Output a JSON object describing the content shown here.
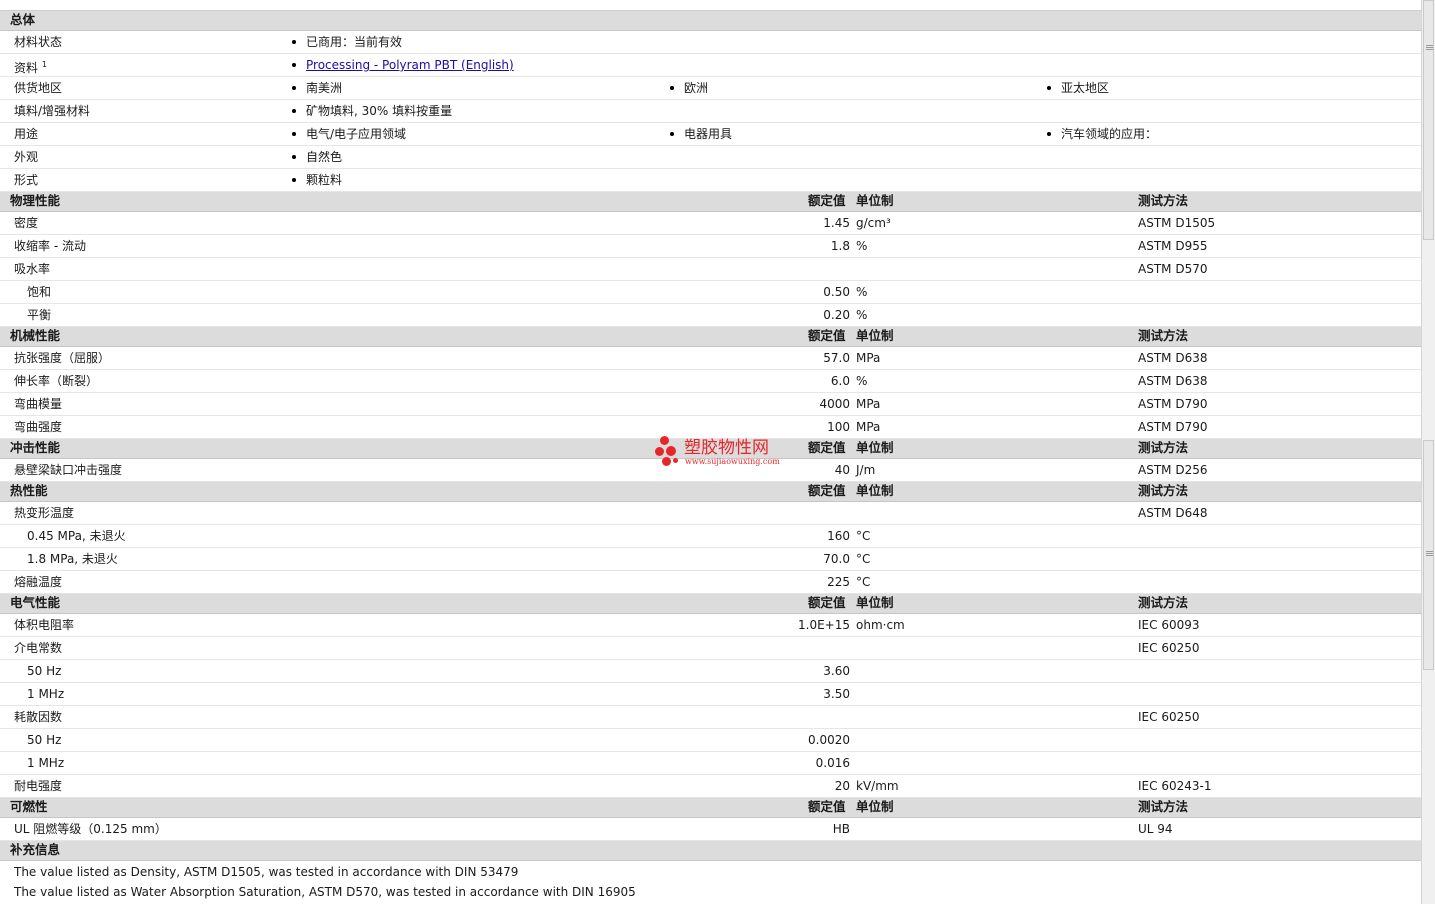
{
  "general": {
    "title": "总体",
    "material_status": {
      "label": "材料状态",
      "value": "已商用：当前有效"
    },
    "literature": {
      "label": "资料",
      "sup": "1",
      "link": "Processing - Polyram PBT (English)"
    },
    "availability": {
      "label": "供货地区",
      "items": [
        "南美洲",
        "欧洲",
        "亚太地区"
      ]
    },
    "filler": {
      "label": "填料/增强材料",
      "value": "矿物填料, 30% 填料按重量"
    },
    "uses": {
      "label": "用途",
      "items": [
        "电气/电子应用领域",
        "电器用具",
        "汽车领域的应用："
      ]
    },
    "appearance": {
      "label": "外观",
      "value": "自然色"
    },
    "form": {
      "label": "形式",
      "value": "颗粒料"
    }
  },
  "headers": {
    "nominal": "额定值",
    "unit": "单位制",
    "test": "测试方法"
  },
  "physical": {
    "title": "物理性能",
    "density": {
      "label": "密度",
      "value": "1.45",
      "unit": "g/cm³",
      "test": "ASTM D1505"
    },
    "shrinkage": {
      "label": "收缩率 - 流动",
      "value": "1.8",
      "unit": "%",
      "test": "ASTM D955"
    },
    "absorption": {
      "label": "吸水率",
      "test": "ASTM D570"
    },
    "saturation": {
      "label": "饱和",
      "value": "0.50",
      "unit": "%"
    },
    "equilibrium": {
      "label": "平衡",
      "value": "0.20",
      "unit": "%"
    }
  },
  "mechanical": {
    "title": "机械性能",
    "tensile": {
      "label": "抗张强度（屈服）",
      "value": "57.0",
      "unit": "MPa",
      "test": "ASTM D638"
    },
    "elongation": {
      "label": "伸长率（断裂）",
      "value": "6.0",
      "unit": "%",
      "test": "ASTM D638"
    },
    "flex_mod": {
      "label": "弯曲模量",
      "value": "4000",
      "unit": "MPa",
      "test": "ASTM D790"
    },
    "flex_str": {
      "label": "弯曲强度",
      "value": "100",
      "unit": "MPa",
      "test": "ASTM D790"
    }
  },
  "impact": {
    "title": "冲击性能",
    "izod": {
      "label": "悬壁梁缺口冲击强度",
      "value": "40",
      "unit": "J/m",
      "test": "ASTM D256"
    }
  },
  "thermal": {
    "title": "热性能",
    "hdt": {
      "label": "热变形温度",
      "test": "ASTM D648"
    },
    "hdt_045": {
      "label": "0.45 MPa, 未退火",
      "value": "160",
      "unit": "°C"
    },
    "hdt_18": {
      "label": "1.8 MPa, 未退火",
      "value": "70.0",
      "unit": "°C"
    },
    "melt": {
      "label": "熔融温度",
      "value": "225",
      "unit": "°C"
    }
  },
  "electrical": {
    "title": "电气性能",
    "resistivity": {
      "label": "体积电阻率",
      "value": "1.0E+15",
      "unit": "ohm·cm",
      "test": "IEC 60093"
    },
    "dielectric": {
      "label": "介电常数",
      "test": "IEC 60250"
    },
    "diel_50hz": {
      "label": "50 Hz",
      "value": "3.60"
    },
    "diel_1mhz": {
      "label": "1 MHz",
      "value": "3.50"
    },
    "dissipation": {
      "label": "耗散因数",
      "test": "IEC 60250"
    },
    "diss_50hz": {
      "label": "50 Hz",
      "value": "0.0020"
    },
    "diss_1mhz": {
      "label": "1 MHz",
      "value": "0.016"
    },
    "strength": {
      "label": "耐电强度",
      "value": "20",
      "unit": "kV/mm",
      "test": "IEC 60243-1"
    }
  },
  "flammability": {
    "title": "可燃性",
    "ul": {
      "label": "UL 阻燃等级（0.125 mm）",
      "value": "HB",
      "test": "UL 94"
    }
  },
  "additional": {
    "title": "补充信息",
    "note1": "The value listed as Density, ASTM D1505, was tested in accordance with DIN 53479",
    "note2": "The value listed as Water Absorption Saturation, ASTM D570, was tested in accordance with DIN 16905"
  },
  "watermark": {
    "text": "塑胶物性网",
    "url": "www.sujiaowuxing.com"
  }
}
